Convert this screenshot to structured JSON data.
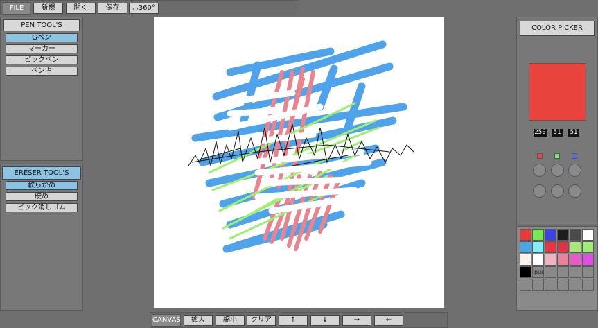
{
  "topbar": {
    "file": "FILE",
    "new": "新規",
    "open": "開く",
    "save": "保存",
    "rotate": "360°"
  },
  "pen_panel": {
    "title": "PEN TOOL'S",
    "items": [
      "Gペン",
      "マーカー",
      "ピックペン",
      "ペンキ"
    ],
    "selected": "Gペン"
  },
  "eraser_panel": {
    "title": "ERESER TOOL'S",
    "items": [
      "軟らかめ",
      "硬め",
      "ピック消しゴム"
    ],
    "selected": "軟らかめ"
  },
  "color_picker": {
    "title": "COLOR PICKER",
    "current": "#e8433d",
    "r": "250",
    "g": "51",
    "b": "51",
    "channel_colors": [
      "#e84b4b",
      "#7ce870",
      "#5a6de8"
    ]
  },
  "palette": {
    "colors": [
      "#e53b3b",
      "#77ea52",
      "#3a44e6",
      "#1e1e1e",
      "#4a4a4a",
      "#ffffff",
      "#49a7e9",
      "#7defff",
      "#e8353f",
      "#e03446",
      "#a6e87a",
      "#9ded76",
      "#fbf2ea",
      "#ffffff",
      "#f0b3c0",
      "#e8839a",
      "#e95ac7",
      "#e14ee6",
      "#000000",
      "#8a8a8a",
      "#8a8a8a",
      "#8a8a8a",
      "#8a8a8a",
      "#8a8a8a",
      "#8a8a8a",
      "#8a8a8a",
      "#8a8a8a",
      "#8a8a8a",
      "#8a8a8a",
      "#8a8a8a"
    ],
    "push_label": "push"
  },
  "bottombar": {
    "canvas": "CANVAS",
    "zoom_in": "拡大",
    "zoom_out": "縮小",
    "clear": "クリア",
    "up": "↑",
    "down": "↓",
    "right": "→",
    "left": "←"
  },
  "colors": {
    "canvas_bg": "#ffffff",
    "stroke_blue": "#4ea3ea",
    "stroke_pink": "#e9848f",
    "stroke_green": "#9ef06f",
    "stroke_black": "#111111",
    "accent": "#8cc2e2"
  }
}
